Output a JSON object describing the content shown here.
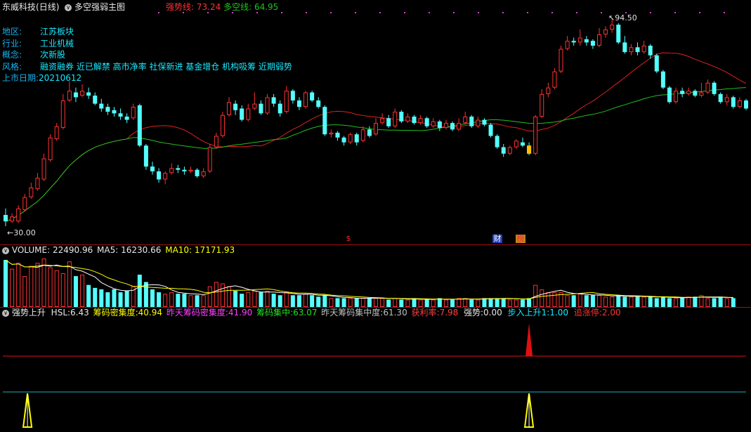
{
  "title": {
    "stock": "东威科技",
    "period": "(日线)",
    "formula": "多空强弱主图",
    "strong_label": "强势线:",
    "strong_value": "73.24",
    "bullbear_label": "多空线:",
    "bullbear_value": "64.95"
  },
  "info": {
    "region_label": "地区:",
    "region_value": "江苏板块",
    "industry_label": "行业:",
    "industry_value": "工业机械",
    "concept_label": "概念:",
    "concept_value": "次新股",
    "style_label": "风格:",
    "style_value": "融资融券 近已解禁 高市净率 社保新进 基金增仓 机构吸筹 近期弱势",
    "listing_label": "上市日期:",
    "listing_value": "20210612"
  },
  "price_marks": {
    "high": "94.50",
    "low": "30.00"
  },
  "event_markers": {
    "s": "$",
    "cai": "财",
    "bang": "榜"
  },
  "volume_panel": {
    "volume_label": "VOLUME:",
    "volume_value": "22490.96",
    "ma5_label": "MA5:",
    "ma5_value": "16230.66",
    "ma10_label": "MA10:",
    "ma10_value": "17171.93"
  },
  "indicator_panel": {
    "name": "强势上升",
    "hsl_label": "HSL:",
    "hsl_value": "6.43",
    "chip_density_label": "筹码密集度:",
    "chip_density_value": "40.94",
    "prev_density_label": "昨天筹码密集度:",
    "prev_density_value": "41.90",
    "chip_conc_label": "筹码集中:",
    "chip_conc_value": "63.07",
    "prev_conc_label": "昨天筹码集中度:",
    "prev_conc_value": "61.30",
    "profit_label": "获利率:",
    "profit_value": "7.98",
    "strength_label": "强势:",
    "strength_value": "0.00",
    "step_label": "步入上升1:",
    "step_value": "1.00",
    "limit_label": "追涨停:",
    "limit_value": "2.00"
  },
  "colors": {
    "up": "#ff3232",
    "down": "#54ffff",
    "ma_red": "#e02020",
    "ma_green": "#20c020",
    "vol_ma5": "#ffffff",
    "vol_ma10": "#ffff00",
    "signal_red": "#e01010",
    "signal_yellow": "#ffff00"
  },
  "chart_data": {
    "type": "candlestick",
    "ylim": [
      30.0,
      94.5
    ],
    "candles": [
      [
        33.5,
        31.5,
        35.5,
        30.0
      ],
      [
        31.5,
        33.0,
        34.0,
        31.0
      ],
      [
        31.5,
        35.5,
        36.5,
        31.0
      ],
      [
        35.0,
        39.0,
        40.0,
        34.5
      ],
      [
        39.0,
        42.0,
        43.5,
        38.5
      ],
      [
        41.5,
        45.0,
        46.5,
        41.0
      ],
      [
        44.5,
        51.0,
        52.5,
        44.0
      ],
      [
        50.5,
        57.5,
        58.5,
        50.0
      ],
      [
        57.0,
        61.0,
        62.0,
        56.5
      ],
      [
        60.5,
        69.0,
        71.0,
        60.0
      ],
      [
        69.0,
        72.0,
        75.0,
        68.5
      ],
      [
        71.5,
        70.0,
        73.0,
        68.5
      ],
      [
        70.5,
        72.0,
        74.0,
        70.0
      ],
      [
        71.5,
        70.5,
        73.0,
        69.5
      ],
      [
        70.5,
        68.0,
        71.5,
        67.5
      ],
      [
        68.0,
        66.5,
        69.5,
        65.5
      ],
      [
        67.0,
        65.5,
        68.0,
        64.5
      ],
      [
        66.0,
        65.0,
        67.0,
        64.0
      ],
      [
        65.0,
        64.0,
        66.5,
        63.0
      ],
      [
        64.0,
        63.0,
        65.0,
        62.0
      ],
      [
        63.5,
        67.0,
        68.0,
        63.0
      ],
      [
        67.5,
        55.0,
        68.0,
        54.5
      ],
      [
        55.0,
        48.5,
        55.5,
        47.5
      ],
      [
        48.5,
        47.0,
        50.0,
        46.0
      ],
      [
        47.0,
        44.5,
        48.0,
        43.5
      ],
      [
        44.5,
        46.5,
        47.0,
        43.0
      ],
      [
        46.5,
        48.0,
        49.5,
        46.0
      ],
      [
        48.0,
        47.5,
        49.0,
        46.5
      ],
      [
        47.5,
        47.0,
        48.5,
        46.0
      ],
      [
        47.0,
        47.5,
        48.5,
        46.5
      ],
      [
        47.5,
        45.5,
        48.0,
        45.0
      ],
      [
        45.5,
        47.0,
        48.0,
        45.0
      ],
      [
        47.0,
        54.5,
        55.5,
        46.5
      ],
      [
        54.5,
        58.0,
        59.0,
        54.0
      ],
      [
        58.0,
        64.5,
        65.5,
        57.5
      ],
      [
        64.5,
        68.5,
        70.0,
        64.0
      ],
      [
        68.0,
        66.0,
        69.0,
        64.5
      ],
      [
        66.5,
        63.0,
        67.5,
        62.5
      ],
      [
        63.0,
        66.5,
        68.0,
        62.5
      ],
      [
        66.5,
        68.0,
        71.5,
        66.0
      ],
      [
        68.0,
        65.0,
        69.0,
        64.5
      ],
      [
        65.0,
        70.0,
        71.0,
        64.5
      ],
      [
        70.0,
        68.0,
        71.0,
        67.0
      ],
      [
        68.0,
        65.0,
        69.0,
        64.0
      ],
      [
        65.5,
        72.0,
        73.5,
        65.0
      ],
      [
        72.0,
        69.0,
        72.5,
        68.0
      ],
      [
        69.0,
        67.0,
        70.0,
        66.0
      ],
      [
        67.0,
        71.5,
        72.0,
        66.5
      ],
      [
        71.5,
        69.0,
        72.0,
        68.5
      ],
      [
        69.0,
        67.0,
        70.0,
        66.5
      ],
      [
        67.0,
        58.5,
        67.5,
        58.0
      ],
      [
        58.5,
        59.0,
        60.0,
        57.5
      ],
      [
        59.0,
        57.5,
        59.5,
        56.5
      ],
      [
        57.5,
        56.0,
        58.0,
        55.0
      ],
      [
        56.0,
        58.5,
        59.0,
        55.5
      ],
      [
        58.5,
        56.0,
        59.0,
        55.0
      ],
      [
        56.5,
        60.0,
        61.0,
        56.0
      ],
      [
        60.0,
        58.0,
        61.0,
        57.5
      ],
      [
        58.5,
        62.0,
        63.5,
        58.0
      ],
      [
        62.0,
        63.5,
        65.0,
        61.5
      ],
      [
        63.5,
        61.0,
        64.5,
        60.5
      ],
      [
        61.0,
        65.5,
        66.5,
        60.5
      ],
      [
        65.5,
        62.5,
        66.0,
        62.0
      ],
      [
        62.5,
        64.0,
        65.0,
        62.0
      ],
      [
        64.0,
        62.0,
        64.5,
        61.5
      ],
      [
        62.0,
        63.5,
        64.5,
        61.5
      ],
      [
        63.5,
        61.0,
        64.0,
        60.5
      ],
      [
        61.0,
        62.5,
        63.5,
        60.5
      ],
      [
        62.5,
        60.5,
        63.0,
        59.5
      ],
      [
        60.5,
        62.0,
        63.0,
        60.0
      ],
      [
        62.0,
        60.0,
        62.5,
        59.5
      ],
      [
        60.0,
        62.0,
        63.5,
        59.5
      ],
      [
        62.0,
        64.0,
        65.5,
        61.5
      ],
      [
        64.0,
        61.0,
        64.5,
        60.5
      ],
      [
        61.0,
        63.0,
        64.0,
        60.5
      ],
      [
        63.0,
        61.5,
        63.5,
        61.0
      ],
      [
        61.5,
        58.0,
        62.0,
        57.5
      ],
      [
        58.0,
        54.5,
        58.5,
        54.0
      ],
      [
        54.5,
        52.5,
        55.5,
        51.5
      ],
      [
        52.5,
        54.5,
        55.0,
        52.0
      ],
      [
        54.5,
        56.5,
        57.0,
        54.0
      ],
      [
        56.0,
        55.0,
        57.5,
        54.5
      ],
      [
        55.0,
        52.5,
        56.0,
        52.0
      ],
      [
        52.5,
        64.0,
        64.5,
        52.0
      ],
      [
        64.0,
        71.0,
        72.5,
        63.5
      ],
      [
        71.0,
        73.0,
        74.5,
        70.0
      ],
      [
        73.0,
        78.0,
        79.0,
        72.5
      ],
      [
        78.0,
        85.0,
        86.0,
        77.5
      ],
      [
        85.0,
        87.5,
        89.0,
        84.5
      ],
      [
        87.5,
        87.0,
        88.5,
        86.0
      ],
      [
        87.0,
        88.5,
        91.0,
        86.0
      ],
      [
        88.0,
        87.0,
        89.0,
        86.0
      ],
      [
        87.5,
        86.0,
        88.0,
        85.0
      ],
      [
        86.0,
        89.5,
        91.5,
        85.5
      ],
      [
        89.5,
        91.0,
        92.0,
        88.5
      ],
      [
        91.0,
        92.5,
        94.5,
        90.0
      ],
      [
        92.5,
        87.0,
        93.0,
        86.5
      ],
      [
        87.0,
        84.0,
        89.0,
        83.5
      ],
      [
        84.0,
        85.5,
        86.5,
        83.0
      ],
      [
        85.5,
        84.0,
        87.0,
        83.0
      ],
      [
        84.0,
        86.0,
        87.5,
        83.5
      ],
      [
        86.0,
        83.0,
        86.5,
        82.0
      ],
      [
        83.0,
        78.0,
        83.5,
        77.5
      ],
      [
        78.0,
        73.0,
        78.5,
        72.5
      ],
      [
        73.0,
        68.5,
        73.5,
        68.0
      ],
      [
        68.5,
        72.0,
        73.0,
        68.0
      ],
      [
        72.0,
        71.0,
        73.0,
        70.0
      ],
      [
        71.0,
        72.0,
        73.0,
        70.5
      ],
      [
        72.0,
        70.5,
        72.5,
        70.0
      ],
      [
        70.5,
        71.5,
        74.5,
        70.0
      ],
      [
        71.5,
        74.5,
        75.5,
        71.0
      ],
      [
        74.5,
        71.0,
        75.0,
        70.5
      ],
      [
        71.0,
        68.5,
        71.5,
        68.0
      ],
      [
        68.5,
        70.0,
        71.0,
        67.5
      ],
      [
        70.0,
        67.0,
        70.5,
        66.5
      ],
      [
        67.0,
        69.0,
        70.0,
        66.5
      ],
      [
        69.0,
        66.5,
        69.5,
        66.0
      ]
    ],
    "volume": [
      32,
      26,
      30,
      21,
      28,
      30,
      33,
      27,
      25,
      23,
      31,
      21,
      22,
      15,
      13,
      12,
      10,
      12,
      10,
      11,
      14,
      22,
      17,
      12,
      10,
      9,
      10,
      9,
      9,
      8,
      8,
      8,
      14,
      17,
      16,
      14,
      11,
      9,
      10,
      11,
      10,
      11,
      9,
      8,
      10,
      8,
      8,
      9,
      8,
      7,
      8,
      6,
      6,
      6,
      6,
      6,
      6,
      6,
      6,
      6,
      5,
      6,
      5,
      5,
      6,
      5,
      5,
      5,
      6,
      5,
      5,
      6,
      6,
      5,
      5,
      6,
      6,
      6,
      6,
      5,
      5,
      5,
      6,
      15,
      12,
      10,
      10,
      10,
      8,
      8,
      9,
      8,
      8,
      8,
      7,
      7,
      8,
      7,
      7,
      7,
      7,
      7,
      6,
      7,
      6,
      6,
      6,
      7,
      7,
      8,
      6,
      6,
      7,
      6,
      6
    ]
  }
}
